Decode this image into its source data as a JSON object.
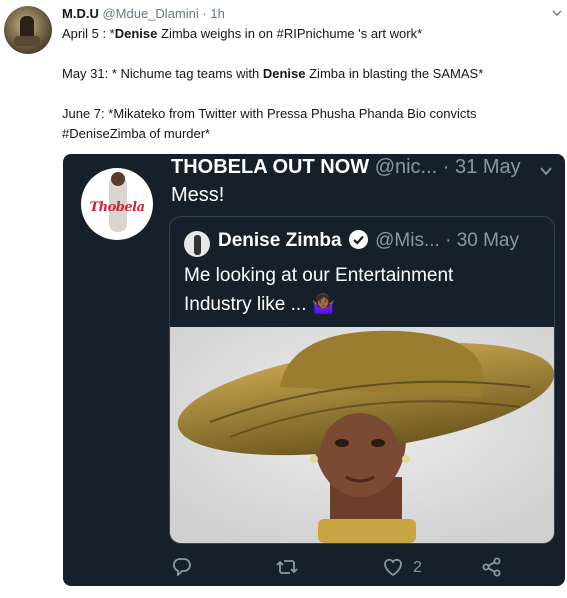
{
  "tweet": {
    "display_name": "M.D.U",
    "handle": "@Mdue_Dlamini",
    "separator": "·",
    "time": "1h",
    "lines": [
      {
        "pre": "April 5 : *",
        "bold": "Denise",
        "post": " Zimba weighs in on #RIPnichume 's art work*"
      },
      {
        "pre": "May 31: * Nichume tag teams with ",
        "bold": "Denise",
        "post": " Zimba in blasting the SAMAS*"
      },
      {
        "pre": "June 7: *Mikateko from Twitter with Pressa Phusha Phanda Bio convicts",
        "bold": "",
        "post": ""
      },
      {
        "pre": "#DeniseZimba of murder*",
        "bold": "",
        "post": ""
      }
    ]
  },
  "embedded": {
    "display_name": "THOBELA OUT NOW",
    "handle": "@nic...",
    "separator": "·",
    "time": "31 May",
    "text": "Mess!",
    "avatar_logo_text": "Thobela",
    "quote": {
      "display_name": "Denise Zimba",
      "handle": "@Mis...",
      "separator": "·",
      "time": "30 May",
      "text_line1": "Me looking at our Entertainment",
      "text_line2": "Industry like ... 🤷🏾‍♀️"
    },
    "actions": {
      "reply_icon": "reply-icon",
      "retweet_icon": "retweet-icon",
      "like_icon": "heart-icon",
      "like_count": "2",
      "share_icon": "share-icon"
    }
  },
  "colors": {
    "card_bg": "#15202b",
    "muted": "#8899a6",
    "text_dark": "#14171a"
  }
}
